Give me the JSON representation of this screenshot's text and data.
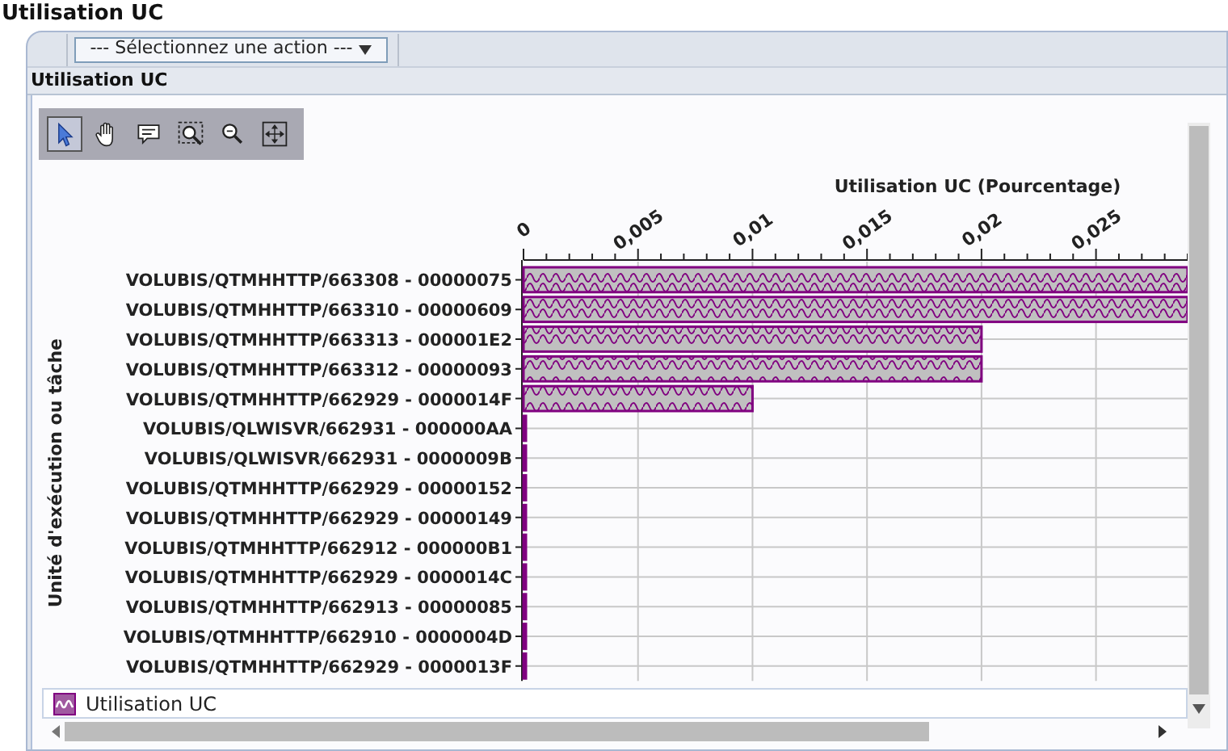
{
  "page_title": "Utilisation UC",
  "toolbar": {
    "action_select": "--- Sélectionnez une action ---"
  },
  "panel": {
    "title": "Utilisation UC"
  },
  "chart_tools": [
    {
      "kind": "pointer",
      "selected": true
    },
    {
      "kind": "hand",
      "selected": false
    },
    {
      "kind": "tooltip",
      "selected": false
    },
    {
      "kind": "zoom_area",
      "selected": false
    },
    {
      "kind": "zoom_out",
      "selected": false
    },
    {
      "kind": "fit",
      "selected": false
    }
  ],
  "chart": {
    "chart_data": {
      "type": "bar",
      "orientation": "horizontal",
      "xlabel": "Utilisation UC (Pourcentage)",
      "ylabel": "Unité d'exécution ou tâche",
      "categories": [
        "VOLUBIS/QTMHHTTP/663308 - 00000075",
        "VOLUBIS/QTMHHTTP/663310 - 00000609",
        "VOLUBIS/QTMHHTTP/663313 - 000001E2",
        "VOLUBIS/QTMHHTTP/663312 - 00000093",
        "VOLUBIS/QTMHHTTP/662929 - 0000014F",
        "VOLUBIS/QLWISVR/662931 - 000000AA",
        "VOLUBIS/QLWISVR/662931 - 0000009B",
        "VOLUBIS/QTMHHTTP/662929 - 00000152",
        "VOLUBIS/QTMHHTTP/662929 - 00000149",
        "VOLUBIS/QTMHHTTP/662912 - 000000B1",
        "VOLUBIS/QTMHHTTP/662929 - 0000014C",
        "VOLUBIS/QTMHHTTP/662913 - 00000085",
        "VOLUBIS/QTMHHTTP/662910 - 0000004D",
        "VOLUBIS/QTMHHTTP/662929 - 0000013F"
      ],
      "series": [
        {
          "name": "Utilisation UC",
          "color": "#800080",
          "values": [
            0.029,
            0.029,
            0.02,
            0.02,
            0.01,
            0,
            0,
            0,
            0,
            0,
            0,
            0,
            0,
            0
          ]
        }
      ],
      "xlim": [
        0,
        0.029
      ],
      "grid": true,
      "xticks": [
        {
          "value": 0,
          "label": "0"
        },
        {
          "value": 0.005,
          "label": "0,005"
        },
        {
          "value": 0.01,
          "label": "0,01"
        },
        {
          "value": 0.015,
          "label": "0,015"
        },
        {
          "value": 0.02,
          "label": "0,02"
        },
        {
          "value": 0.025,
          "label": "0,025"
        }
      ]
    }
  }
}
